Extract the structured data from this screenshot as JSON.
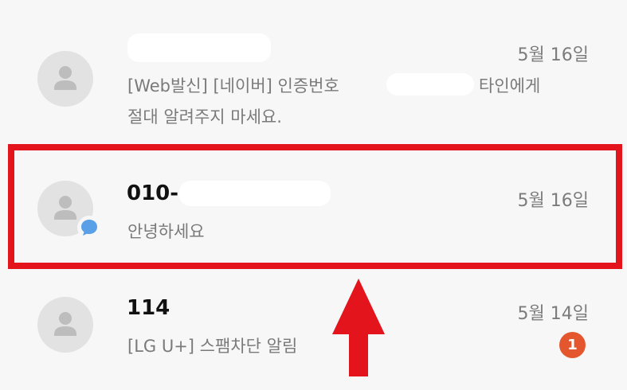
{
  "conversations": [
    {
      "name": "",
      "date": "5월 16일",
      "message_line1_a": "[Web발신] [네이버] 인증번호",
      "message_line1_b": "타인에게",
      "message_line2": "절대 알려주지 마세요."
    },
    {
      "name": "010-",
      "date": "5월 16일",
      "message": "안녕하세요"
    },
    {
      "name": "114",
      "date": "5월 14일",
      "message": "[LG U+] 스팸차단 알림",
      "unread_count": "1"
    }
  ],
  "colors": {
    "highlight_border": "#e3141b",
    "arrow": "#e3141b",
    "unread_badge": "#e4572e",
    "chat_bubble_icon": "#5aa0e6"
  },
  "icons": {
    "avatar": "person-icon",
    "chat": "chat-bubble-icon",
    "annotation": "up-arrow"
  }
}
